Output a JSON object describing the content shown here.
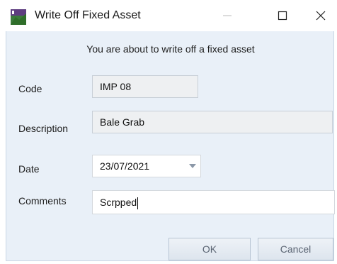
{
  "window": {
    "title": "Write Off Fixed Asset",
    "icon": "fixed-asset-app-icon",
    "controls": {
      "minimize_icon": "minimize-icon",
      "maximize_icon": "maximize-icon",
      "close_icon": "close-icon"
    }
  },
  "dialog": {
    "notice": "You are about to write off a fixed asset",
    "fields": {
      "code": {
        "label": "Code",
        "value": "IMP 08"
      },
      "description": {
        "label": "Description",
        "value": "Bale Grab"
      },
      "date": {
        "label": "Date",
        "value": "23/07/2021"
      },
      "comments": {
        "label": "Comments",
        "value": "Scrpped"
      }
    },
    "buttons": {
      "ok": "OK",
      "cancel": "Cancel"
    }
  },
  "colors": {
    "content_bg": "#e9f0f8",
    "readonly_field_bg": "#eef0f2",
    "button_text": "#5b6573"
  }
}
